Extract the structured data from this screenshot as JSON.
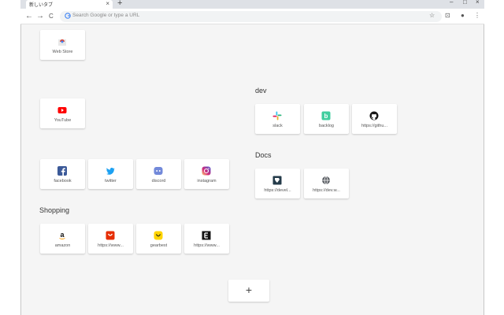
{
  "browser": {
    "tab_title": "新しいタブ",
    "tab_close": "×",
    "new_tab": "+",
    "min": "–",
    "max": "□",
    "close": "×",
    "back": "←",
    "forward": "→",
    "reload": "C",
    "omnibox_placeholder": "Search Google or type a URL",
    "star": "☆",
    "ext": "⊡",
    "profile": "●",
    "menu": "⋮"
  },
  "tiles": {
    "webstore": "Web Store",
    "youtube": "YouTube",
    "facebook": "facebook",
    "twitter": "twitter",
    "discord": "discord",
    "instagram": "instagram",
    "amazon": "amazon",
    "aliexpress": "https://www...",
    "gearbest": "gearbest",
    "elementor": "https://www...",
    "slack": "slack",
    "backlog": "backlog",
    "github": "https://githu...",
    "docs1": "https://devel...",
    "docs2": "https://dev.w..."
  },
  "groups": {
    "shopping": "Shopping",
    "dev": "dev",
    "docs": "Docs"
  },
  "add_button": "+",
  "colors": {
    "facebook": "#3b5998",
    "twitter": "#1da1f2",
    "discord": "#7289da",
    "youtube": "#ff0000",
    "aliexpress": "#e62e04",
    "gearbest": "#ffd400",
    "backlog": "#42ce9f"
  }
}
